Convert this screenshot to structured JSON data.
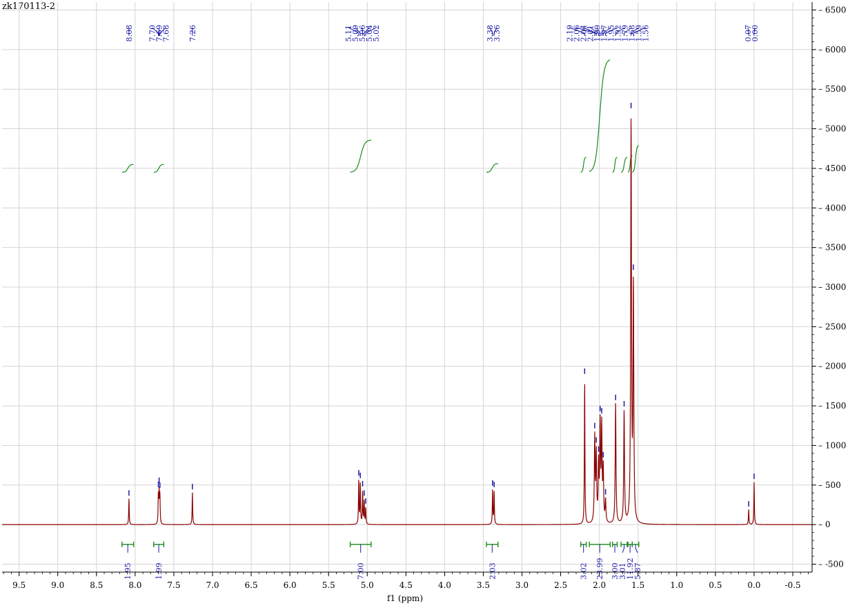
{
  "title": "zk170113-2",
  "colors": {
    "spectrum": "#8b0000",
    "integral": "#1a8a1a",
    "peak_label": "#1a1aa6",
    "grid": "#d4d4d4",
    "axis": "#000000"
  },
  "chart_data": {
    "type": "line",
    "title": "zk170113-2",
    "xlabel": "f1 (ppm)",
    "ylabel": "",
    "xlim": [
      9.72,
      -0.75
    ],
    "ylim": [
      -600,
      6600
    ],
    "x_reversed": true,
    "grid": true,
    "x_ticks": [
      "9.5",
      "9.0",
      "8.5",
      "8.0",
      "7.5",
      "7.0",
      "6.5",
      "6.0",
      "5.5",
      "5.0",
      "4.5",
      "4.0",
      "3.5",
      "3.0",
      "2.5",
      "2.0",
      "1.5",
      "1.0",
      "0.5",
      "0.0",
      "-0.5"
    ],
    "y_ticks": [
      "-500",
      "0",
      "500",
      "1000",
      "1500",
      "2000",
      "2500",
      "3000",
      "3500",
      "4000",
      "4500",
      "5000",
      "5500",
      "6000",
      "6500"
    ],
    "peak_labels": [
      "8.08",
      "7.70",
      "7.69",
      "7.68",
      "7.26",
      "5.11",
      "5.09",
      "5.06",
      "5.04",
      "5.02",
      "3.38",
      "3.36",
      "2.19",
      "2.06",
      "2.04",
      "2.01",
      "1.99",
      "1.97",
      "1.95",
      "1.92",
      "1.79",
      "1.68",
      "1.59",
      "1.56",
      "0.07",
      "0.00"
    ],
    "peaks": [
      {
        "x": 8.08,
        "y": 330
      },
      {
        "x": 7.7,
        "y": 370
      },
      {
        "x": 7.69,
        "y": 390
      },
      {
        "x": 7.68,
        "y": 360
      },
      {
        "x": 7.26,
        "y": 410
      },
      {
        "x": 5.11,
        "y": 560
      },
      {
        "x": 5.09,
        "y": 520
      },
      {
        "x": 5.06,
        "y": 420
      },
      {
        "x": 5.04,
        "y": 300
      },
      {
        "x": 5.02,
        "y": 210
      },
      {
        "x": 3.38,
        "y": 440
      },
      {
        "x": 3.36,
        "y": 420
      },
      {
        "x": 2.19,
        "y": 1860
      },
      {
        "x": 2.06,
        "y": 1080
      },
      {
        "x": 2.04,
        "y": 850
      },
      {
        "x": 2.01,
        "y": 700
      },
      {
        "x": 1.99,
        "y": 1200
      },
      {
        "x": 1.97,
        "y": 1180
      },
      {
        "x": 1.95,
        "y": 660
      },
      {
        "x": 1.92,
        "y": 280
      },
      {
        "x": 1.79,
        "y": 1520
      },
      {
        "x": 1.68,
        "y": 1420
      },
      {
        "x": 1.59,
        "y": 5100
      },
      {
        "x": 1.56,
        "y": 2980
      },
      {
        "x": 0.07,
        "y": 190
      },
      {
        "x": 0.0,
        "y": 540
      }
    ],
    "integrals": [
      {
        "from": 8.17,
        "to": 8.02,
        "value": "1.95",
        "y0": 4450,
        "y1": 4550
      },
      {
        "from": 7.76,
        "to": 7.63,
        "value": "1.99",
        "y0": 4450,
        "y1": 4550
      },
      {
        "from": 5.22,
        "to": 4.95,
        "value": "7.00",
        "y0": 4450,
        "y1": 4860
      },
      {
        "from": 3.46,
        "to": 3.31,
        "value": "2.03",
        "y0": 4450,
        "y1": 4560
      },
      {
        "from": 2.24,
        "to": 2.17,
        "value": "3.02",
        "y0": 4450,
        "y1": 4640
      },
      {
        "from": 2.13,
        "to": 1.86,
        "value": "23.99",
        "y0": 4450,
        "y1": 5880
      },
      {
        "from": 1.83,
        "to": 1.77,
        "value": "3.00",
        "y0": 4450,
        "y1": 4640
      },
      {
        "from": 1.72,
        "to": 1.64,
        "value": "3.01",
        "y0": 4450,
        "y1": 4640
      },
      {
        "from": 1.63,
        "to": 1.575,
        "value": "11.92",
        "y0": 4450,
        "y1": 4660
      },
      {
        "from": 1.575,
        "to": 1.49,
        "value": "5.87",
        "y0": 4450,
        "y1": 4790
      }
    ]
  }
}
